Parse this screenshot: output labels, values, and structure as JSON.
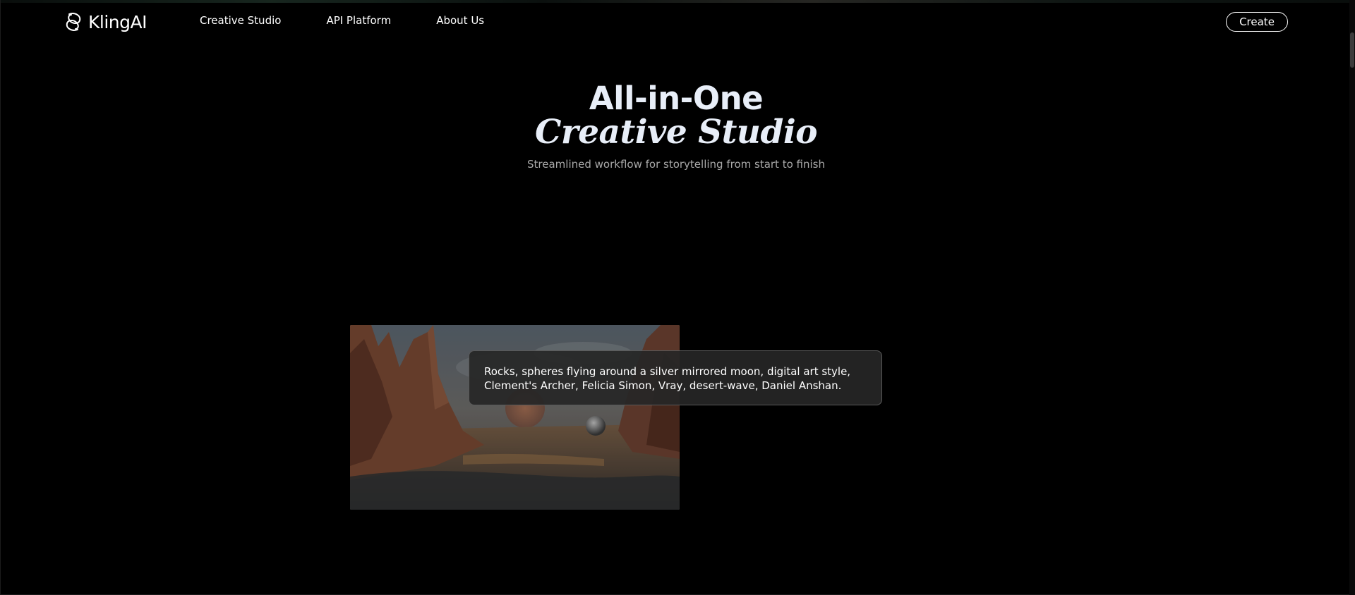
{
  "header": {
    "logo_text": "KlingAI",
    "nav": [
      {
        "label": "Creative Studio"
      },
      {
        "label": "API Platform"
      },
      {
        "label": "About Us"
      }
    ],
    "create_label": "Create"
  },
  "hero": {
    "title_line1": "All-in-One",
    "title_line2": "Creative Studio",
    "subtitle": "Streamlined workflow for storytelling from start to finish"
  },
  "showcase": {
    "prompt": "Rocks, spheres flying around a silver mirrored moon, digital art style, Clement's Archer, Felicia Simon, Vray, desert-wave, Daniel Anshan."
  },
  "colors": {
    "background": "#000000",
    "title": "#e8eef8",
    "subtitle": "#a8a8a8",
    "prompt_bg": "#262626"
  }
}
